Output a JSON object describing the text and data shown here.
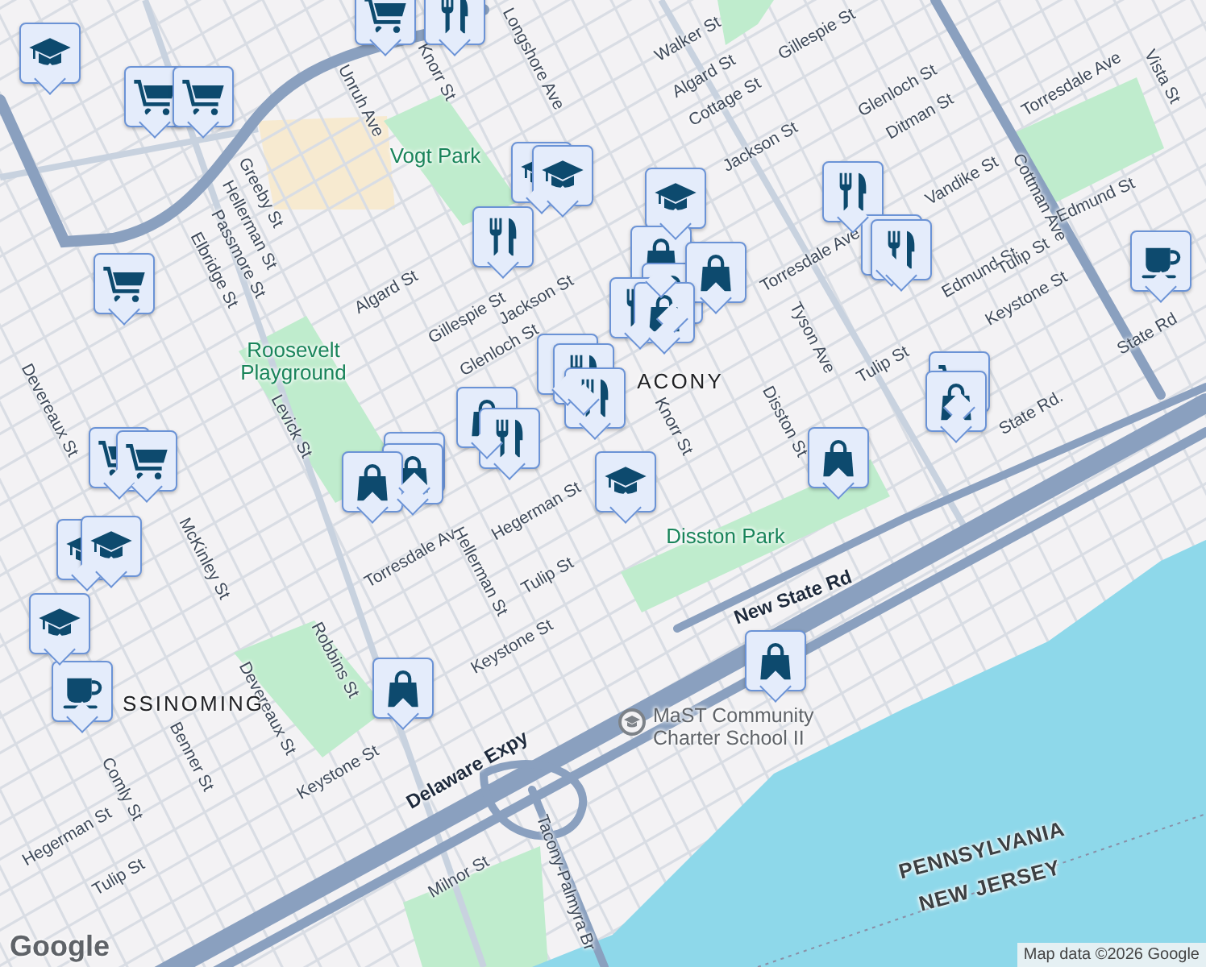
{
  "map": {
    "labels": [
      {
        "text": "Longshore Ave",
        "kind": "street"
      },
      {
        "text": "Knorr St",
        "kind": "street"
      },
      {
        "text": "Unruh Ave",
        "kind": "street"
      },
      {
        "text": "Greeby St",
        "kind": "street"
      },
      {
        "text": "Hellerman St",
        "kind": "street"
      },
      {
        "text": "Passmore St",
        "kind": "street"
      },
      {
        "text": "Elbridge St",
        "kind": "street"
      },
      {
        "text": "Algard St",
        "kind": "street"
      },
      {
        "text": "Gillespie St",
        "kind": "street"
      },
      {
        "text": "Jackson St",
        "kind": "street"
      },
      {
        "text": "Glenloch St",
        "kind": "street"
      },
      {
        "text": "Walker St",
        "kind": "street"
      },
      {
        "text": "Algard St",
        "kind": "street"
      },
      {
        "text": "Cottage St",
        "kind": "street"
      },
      {
        "text": "Gillespie St",
        "kind": "street"
      },
      {
        "text": "Glenloch St",
        "kind": "street"
      },
      {
        "text": "Ditman St",
        "kind": "street"
      },
      {
        "text": "Jackson St",
        "kind": "street"
      },
      {
        "text": "Torresdale Ave",
        "kind": "street"
      },
      {
        "text": "Vista St",
        "kind": "street"
      },
      {
        "text": "Edmund St",
        "kind": "street"
      },
      {
        "text": "Vandike St",
        "kind": "street"
      },
      {
        "text": "Edmund St",
        "kind": "street"
      },
      {
        "text": "Tulip St",
        "kind": "street"
      },
      {
        "text": "Keystone St",
        "kind": "street"
      },
      {
        "text": "Cottman Ave",
        "kind": "street"
      },
      {
        "text": "Torresdale Ave",
        "kind": "street"
      },
      {
        "text": "Tyson Ave",
        "kind": "street"
      },
      {
        "text": "Disston St",
        "kind": "street"
      },
      {
        "text": "Tulip St",
        "kind": "street"
      },
      {
        "text": "State Rd.",
        "kind": "street"
      },
      {
        "text": "State Rd",
        "kind": "street"
      },
      {
        "text": "Knorr St",
        "kind": "street"
      },
      {
        "text": "Hegerman St",
        "kind": "street"
      },
      {
        "text": "Tulip St",
        "kind": "street"
      },
      {
        "text": "Keystone St",
        "kind": "street"
      },
      {
        "text": "Torresdale Av",
        "kind": "street"
      },
      {
        "text": "Hellerman St",
        "kind": "street"
      },
      {
        "text": "Robbins St",
        "kind": "street"
      },
      {
        "text": "Keystone St",
        "kind": "street"
      },
      {
        "text": "Devereaux St",
        "kind": "street"
      },
      {
        "text": "McKinley St",
        "kind": "street"
      },
      {
        "text": "Benner St",
        "kind": "street"
      },
      {
        "text": "Comly St",
        "kind": "street"
      },
      {
        "text": "Hegerman St",
        "kind": "street"
      },
      {
        "text": "Tulip St",
        "kind": "street"
      },
      {
        "text": "Milnor St",
        "kind": "street"
      },
      {
        "text": "Delaware Expy",
        "kind": "highway"
      },
      {
        "text": "New State Rd",
        "kind": "highway"
      },
      {
        "text": "Levick St",
        "kind": "street"
      },
      {
        "text": "Devereaux St",
        "kind": "street"
      },
      {
        "text": "Tacony-Palmyra Br",
        "kind": "street"
      },
      {
        "text": "Vogt Park",
        "kind": "park"
      },
      {
        "text": "Roosevelt Playground",
        "kind": "park"
      },
      {
        "text": "ACONY",
        "kind": "area"
      },
      {
        "text": "Disston Park",
        "kind": "park"
      },
      {
        "text": "SSINOMING",
        "kind": "area"
      },
      {
        "text": "PENNSYLVANIA",
        "kind": "state"
      },
      {
        "text": "NEW JERSEY",
        "kind": "state"
      },
      {
        "text": "MaST Community Charter School II",
        "kind": "place"
      }
    ],
    "pins": [
      {
        "kind": "grocery"
      },
      {
        "kind": "food"
      },
      {
        "kind": "school"
      },
      {
        "kind": "grocery"
      },
      {
        "kind": "grocery"
      },
      {
        "kind": "school"
      },
      {
        "kind": "school"
      },
      {
        "kind": "food"
      },
      {
        "kind": "school"
      },
      {
        "kind": "shop"
      },
      {
        "kind": "food"
      },
      {
        "kind": "food"
      },
      {
        "kind": "food"
      },
      {
        "kind": "shop"
      },
      {
        "kind": "shop"
      },
      {
        "kind": "food"
      },
      {
        "kind": "shop"
      },
      {
        "kind": "cafe"
      },
      {
        "kind": "food"
      },
      {
        "kind": "food"
      },
      {
        "kind": "food"
      },
      {
        "kind": "shop"
      },
      {
        "kind": "food"
      },
      {
        "kind": "food"
      },
      {
        "kind": "shop"
      },
      {
        "kind": "shop"
      },
      {
        "kind": "grocery"
      },
      {
        "kind": "grocery"
      },
      {
        "kind": "grocery"
      },
      {
        "kind": "school"
      },
      {
        "kind": "school"
      },
      {
        "kind": "school"
      },
      {
        "kind": "cafe"
      },
      {
        "kind": "shop"
      },
      {
        "kind": "school"
      },
      {
        "kind": "shop"
      },
      {
        "kind": "grocery"
      },
      {
        "kind": "shop"
      },
      {
        "kind": "shop"
      }
    ]
  },
  "logo": "Google",
  "attribution": "Map data ©2026 Google"
}
